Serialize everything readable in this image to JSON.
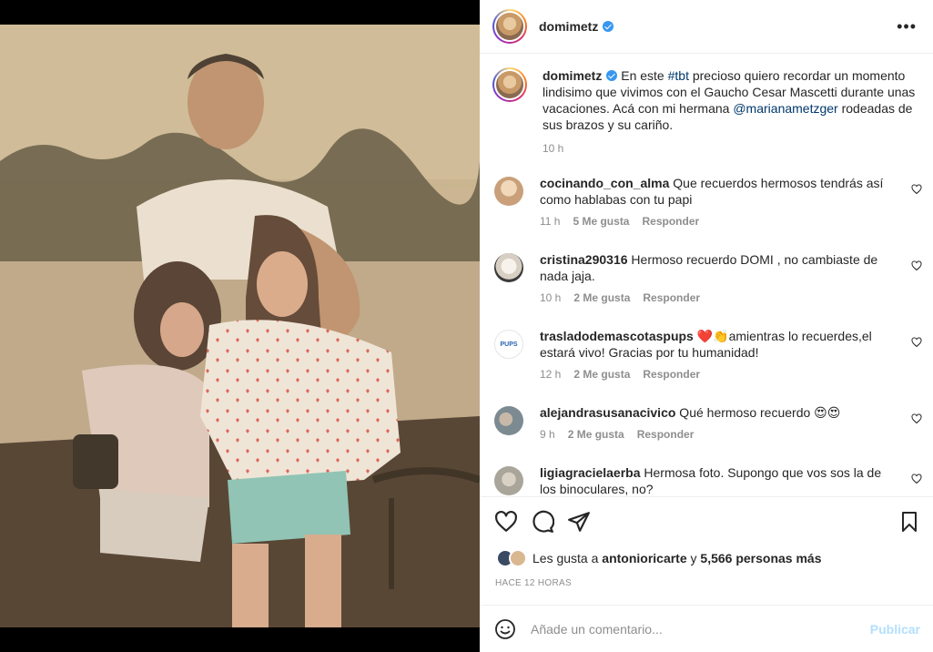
{
  "post": {
    "username": "domimetz",
    "more_icon": "more-horizontal-icon"
  },
  "caption": {
    "username": "domimetz",
    "text_before": " En este ",
    "hashtag": "#tbt",
    "text_middle": " precioso quiero recordar un momento lindisimo que vivimos con el Gaucho Cesar Mascetti durante unas vacaciones. Acá con mi hermana ",
    "mention": "@marianametzger",
    "text_after": " rodeadas de sus brazos y su cariño.",
    "time": "10 h"
  },
  "comments": [
    {
      "username": "cocinando_con_alma",
      "text": " Que recuerdos hermosos tendrás así como hablabas con tu papi",
      "time": "11 h",
      "likes": "5 Me gusta",
      "reply": "Responder",
      "avatar_color": "#c9a07a"
    },
    {
      "username": "cristina290316",
      "text": " Hermoso recuerdo DOMI , no cambiaste de nada jaja.",
      "time": "10 h",
      "likes": "2 Me gusta",
      "reply": "Responder",
      "avatar_color": "#d8cfc4"
    },
    {
      "username": "trasladodemascotaspups",
      "text": " ❤️👏amientras lo recuerdes,el estará vivo! Gracias por tu humanidad!",
      "time": "12 h",
      "likes": "2 Me gusta",
      "reply": "Responder",
      "avatar_color": "#ffffff"
    },
    {
      "username": "alejandrasusanacivico",
      "text": " Qué hermoso recuerdo 😍😍",
      "time": "9 h",
      "likes": "2 Me gusta",
      "reply": "Responder",
      "avatar_color": "#7c8a92"
    },
    {
      "username": "ligiagracielaerba",
      "text": " Hermosa foto. Supongo que vos sos la de los binoculares, no?",
      "time": "",
      "likes": "",
      "reply": "",
      "avatar_color": "#a9a59a"
    }
  ],
  "likes": {
    "prefix": "Les gusta a ",
    "user": "antonioricarte",
    "middle": " y ",
    "count": "5,566 personas más"
  },
  "time_ago": "HACE 12 HORAS",
  "add_comment": {
    "placeholder": "Añade un comentario...",
    "publish": "Publicar"
  },
  "icons": {
    "like": "heart-icon",
    "comment": "comment-icon",
    "share": "share-icon",
    "save": "bookmark-icon",
    "emoji": "emoji-icon"
  },
  "colors": {
    "link": "#00376b",
    "verified": "#3897f0",
    "publish_disabled": "#b2dffc"
  }
}
